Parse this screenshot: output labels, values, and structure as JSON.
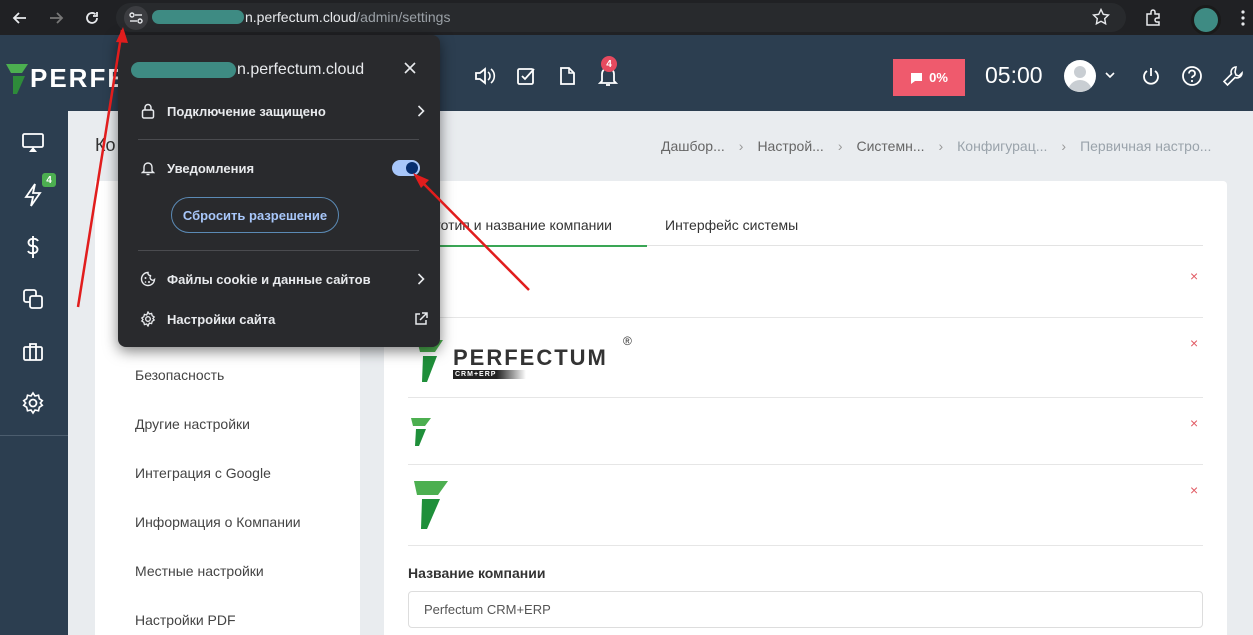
{
  "browser": {
    "url_host": "n.perfectum.cloud",
    "url_path": "/admin/settings",
    "icons": [
      "back-icon",
      "forward-icon",
      "reload-icon",
      "site-settings-icon",
      "star-icon",
      "extensions-icon",
      "profile-avatar",
      "menu-kebab-icon"
    ]
  },
  "header": {
    "logo_text": "PERFE",
    "notification_count": "4",
    "progress_label": "0%",
    "timer": "05:00",
    "icons": [
      "sound-icon",
      "check-square-icon",
      "file-icon",
      "bell-icon",
      "power-icon",
      "help-icon",
      "wrench-icon"
    ]
  },
  "sidebar": {
    "badge": "4",
    "icons": [
      "monitor-icon",
      "bolt-icon",
      "dollar-icon",
      "copy-icon",
      "briefcase-icon",
      "gear-icon"
    ]
  },
  "page": {
    "title": "Ко",
    "breadcrumbs": [
      "Дашбор...",
      "Настрой...",
      "Системн...",
      "Конфигурац...",
      "Первичная настро..."
    ]
  },
  "left_menu": [
    "Безопасность",
    "Другие настройки",
    "Интеграция с Google",
    "Информация о Компании",
    "Местные настройки",
    "Настройки PDF"
  ],
  "main": {
    "tabs": [
      "оготип и название компании",
      "Интерфейс системы"
    ],
    "logo_text": "PERFECTUM",
    "logo_sub": "CRM+ERP",
    "logo_reg": "®",
    "remove_mark": "×",
    "company_label": "Название компании",
    "company_value": "Perfectum CRM+ERP"
  },
  "popup": {
    "host": "n.perfectum.cloud",
    "secure": "Подключение защищено",
    "notifications": "Уведомления",
    "notifications_enabled": true,
    "reset": "Сбросить разрешение",
    "cookies": "Файлы cookie и данные сайтов",
    "site_settings": "Настройки сайта"
  },
  "colors": {
    "accent": "#3aa655",
    "annotation": "#e11d1d",
    "header": "#2c3e50",
    "badge": "#ef5a6d"
  }
}
